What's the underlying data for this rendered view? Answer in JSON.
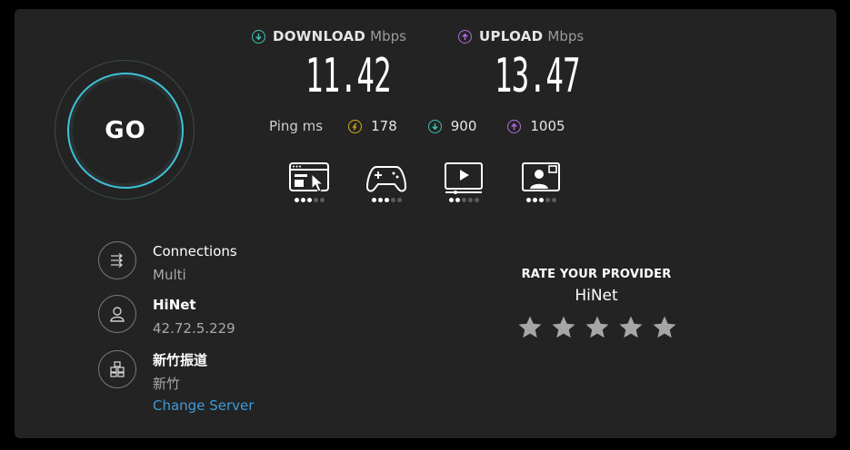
{
  "go": {
    "label": "GO"
  },
  "download": {
    "label": "DOWNLOAD",
    "unit": "Mbps",
    "value": "11.42",
    "color": "#3fc3b5"
  },
  "upload": {
    "label": "UPLOAD",
    "unit": "Mbps",
    "value": "13.47",
    "color": "#b56be0"
  },
  "ping": {
    "label": "Ping ms",
    "idle": {
      "value": "178",
      "color": "#d6b11c"
    },
    "download": {
      "value": "900",
      "color": "#3fc3b5"
    },
    "upload": {
      "value": "1005",
      "color": "#b56be0"
    }
  },
  "activities": [
    {
      "icon": "web-browsing-icon",
      "level": 3
    },
    {
      "icon": "gaming-icon",
      "level": 3
    },
    {
      "icon": "video-streaming-icon",
      "level": 2
    },
    {
      "icon": "video-chat-icon",
      "level": 3
    }
  ],
  "connections": {
    "title": "Connections",
    "value": "Multi"
  },
  "isp": {
    "name": "HiNet",
    "ip": "42.72.5.229"
  },
  "server": {
    "name": "新竹振道",
    "location": "新竹",
    "change_label": "Change Server"
  },
  "rate": {
    "title": "RATE YOUR PROVIDER",
    "provider": "HiNet",
    "stars": 5
  },
  "colors": {
    "accent": "#3fc3d8",
    "link": "#3d9ad9",
    "panel": "#232323"
  }
}
